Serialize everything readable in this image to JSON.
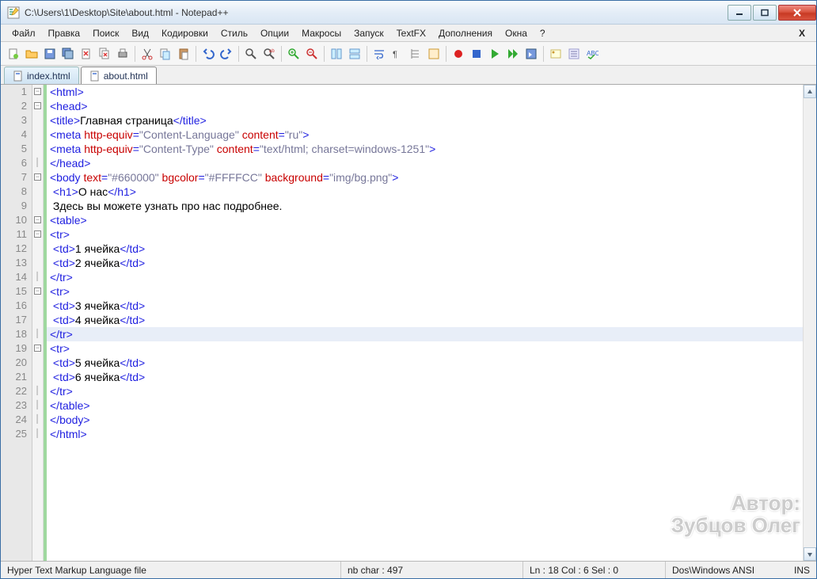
{
  "title": "C:\\Users\\1\\Desktop\\Site\\about.html - Notepad++",
  "menu": [
    "Файл",
    "Правка",
    "Поиск",
    "Вид",
    "Кодировки",
    "Стиль",
    "Опции",
    "Макросы",
    "Запуск",
    "TextFX",
    "Дополнения",
    "Окна",
    "?"
  ],
  "menu_close": "X",
  "tabs": [
    {
      "label": "index.html",
      "active": false
    },
    {
      "label": "about.html",
      "active": true
    }
  ],
  "status": {
    "filetype": "Hyper Text Markup Language file",
    "nbchar": "nb char : 497",
    "pos": "Ln : 18   Col : 6   Sel : 0",
    "encline": "Dos\\Windows   ANSI",
    "insmode": "INS"
  },
  "watermark": {
    "l1": "Автор:",
    "l2": "Зубцов Олег"
  },
  "code": {
    "highlight_line": 18,
    "lines": [
      {
        "n": 1,
        "fold": "-",
        "html": "<span class='tag'>&lt;html&gt;</span>"
      },
      {
        "n": 2,
        "fold": "-",
        "html": "<span class='tag'>&lt;head&gt;</span>"
      },
      {
        "n": 3,
        "fold": "",
        "html": "<span class='tag'>&lt;title&gt;</span><span class='txt'>Главная страница</span><span class='tag'>&lt;/title&gt;</span>"
      },
      {
        "n": 4,
        "fold": "",
        "html": "<span class='tag'>&lt;meta</span> <span class='attr'>http-equiv</span><span class='tag'>=</span><span class='str'>\"Content-Language\"</span> <span class='attr'>content</span><span class='tag'>=</span><span class='str'>\"ru\"</span><span class='tag'>&gt;</span>"
      },
      {
        "n": 5,
        "fold": "",
        "html": "<span class='tag'>&lt;meta</span> <span class='attr'>http-equiv</span><span class='tag'>=</span><span class='str'>\"Content-Type\"</span> <span class='attr'>content</span><span class='tag'>=</span><span class='str'>\"text/html; charset=windows-1251\"</span><span class='tag'>&gt;</span>"
      },
      {
        "n": 6,
        "fold": "|",
        "html": "<span class='tag'>&lt;/head&gt;</span>"
      },
      {
        "n": 7,
        "fold": "-",
        "html": "<span class='tag'>&lt;body</span> <span class='attr'>text</span><span class='tag'>=</span><span class='str'>\"#660000\"</span> <span class='attr'>bgcolor</span><span class='tag'>=</span><span class='str'>\"#FFFFCC\"</span> <span class='attr'>background</span><span class='tag'>=</span><span class='str'>\"img/bg.png\"</span><span class='tag'>&gt;</span>"
      },
      {
        "n": 8,
        "fold": "",
        "html": " <span class='tag'>&lt;h1&gt;</span><span class='txt'>О нас</span><span class='tag'>&lt;/h1&gt;</span>"
      },
      {
        "n": 9,
        "fold": "",
        "html": " <span class='txt'>Здесь вы можете узнать про нас подробнее.</span>"
      },
      {
        "n": 10,
        "fold": "-",
        "html": "<span class='tag'>&lt;table&gt;</span>"
      },
      {
        "n": 11,
        "fold": "-",
        "html": "<span class='tag'>&lt;tr&gt;</span>"
      },
      {
        "n": 12,
        "fold": "",
        "html": " <span class='tag'>&lt;td&gt;</span><span class='txt'>1 ячейка</span><span class='tag'>&lt;/td&gt;</span>"
      },
      {
        "n": 13,
        "fold": "",
        "html": " <span class='tag'>&lt;td&gt;</span><span class='txt'>2 ячейка</span><span class='tag'>&lt;/td&gt;</span>"
      },
      {
        "n": 14,
        "fold": "|",
        "html": "<span class='tag'>&lt;/tr&gt;</span>"
      },
      {
        "n": 15,
        "fold": "-",
        "html": "<span class='tag'>&lt;tr&gt;</span>"
      },
      {
        "n": 16,
        "fold": "",
        "html": " <span class='tag'>&lt;td&gt;</span><span class='txt'>3 ячейка</span><span class='tag'>&lt;/td&gt;</span>"
      },
      {
        "n": 17,
        "fold": "",
        "html": " <span class='tag'>&lt;td&gt;</span><span class='txt'>4 ячейка</span><span class='tag'>&lt;/td&gt;</span>"
      },
      {
        "n": 18,
        "fold": "|",
        "html": "<span class='tag'>&lt;/tr&gt;</span>"
      },
      {
        "n": 19,
        "fold": "-",
        "html": "<span class='tag'>&lt;tr&gt;</span>"
      },
      {
        "n": 20,
        "fold": "",
        "html": " <span class='tag'>&lt;td&gt;</span><span class='txt'>5 ячейка</span><span class='tag'>&lt;/td&gt;</span>"
      },
      {
        "n": 21,
        "fold": "",
        "html": " <span class='tag'>&lt;td&gt;</span><span class='txt'>6 ячейка</span><span class='tag'>&lt;/td&gt;</span>"
      },
      {
        "n": 22,
        "fold": "|",
        "html": "<span class='tag'>&lt;/tr&gt;</span>"
      },
      {
        "n": 23,
        "fold": "|",
        "html": "<span class='tag'>&lt;/table&gt;</span>"
      },
      {
        "n": 24,
        "fold": "|",
        "html": "<span class='tag'>&lt;/body&gt;</span>"
      },
      {
        "n": 25,
        "fold": "|",
        "html": "<span class='tag'>&lt;/html&gt;</span>"
      }
    ]
  }
}
